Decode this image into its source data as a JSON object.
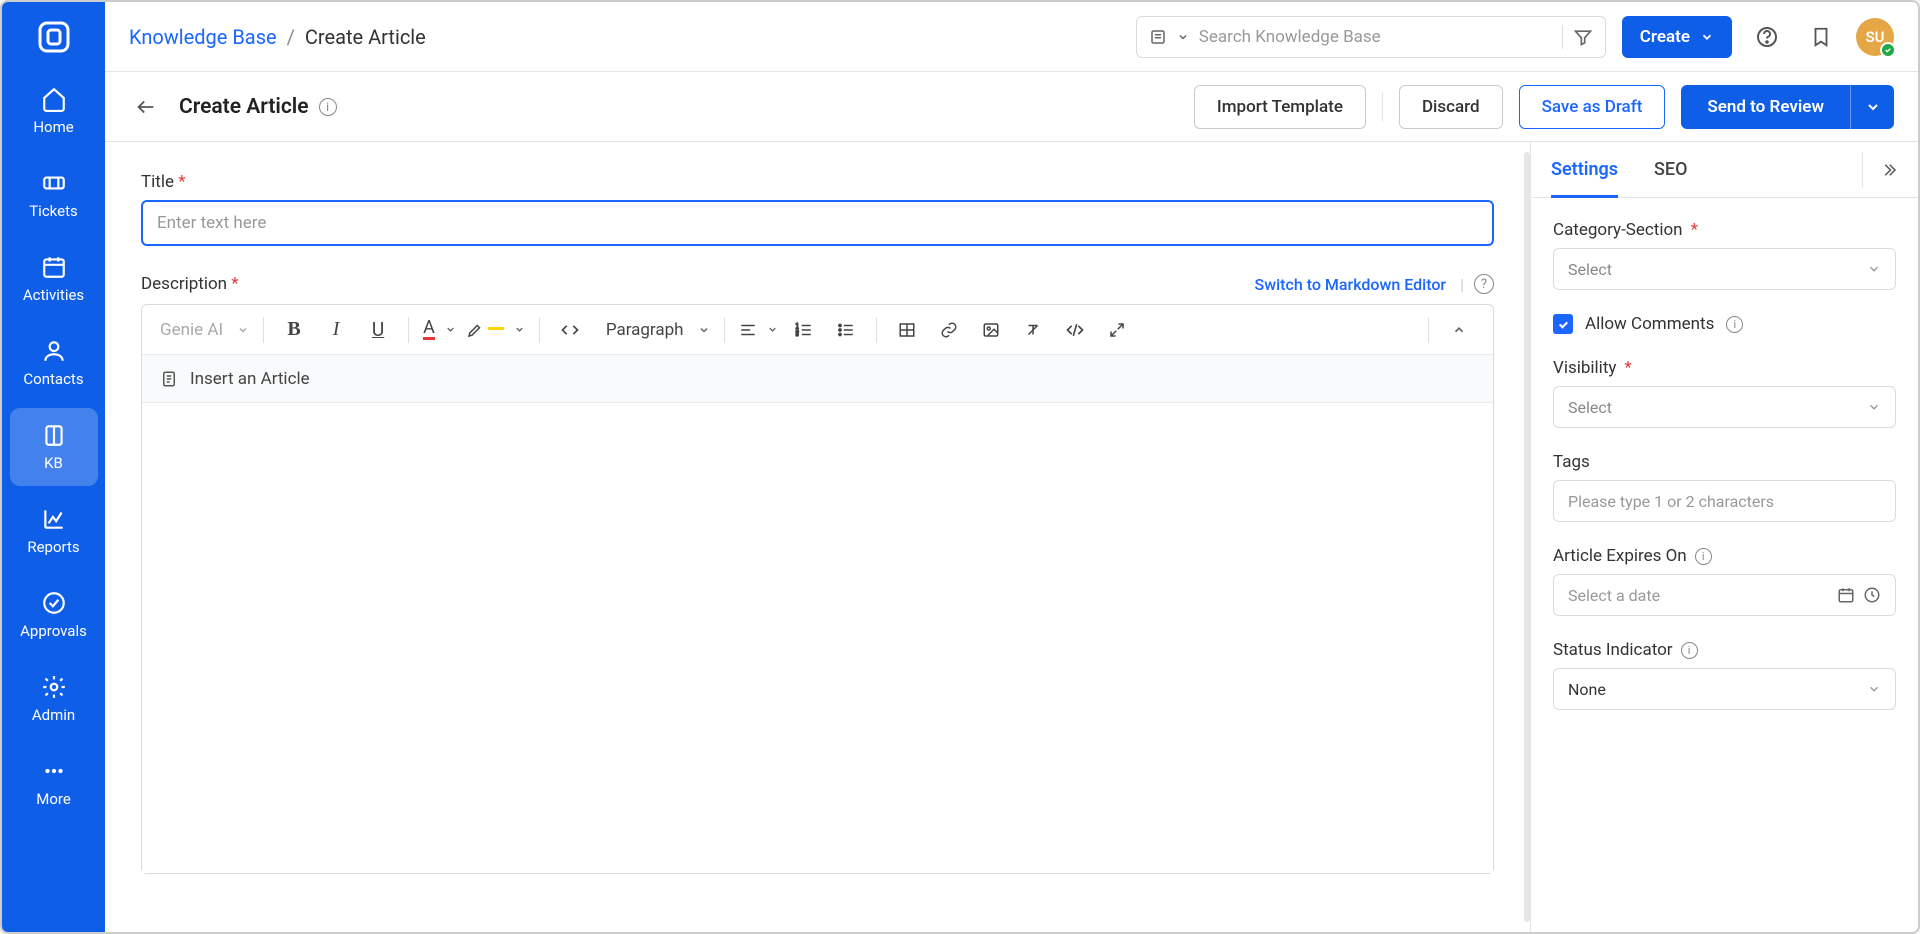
{
  "nav": {
    "items": [
      {
        "label": "Home"
      },
      {
        "label": "Tickets"
      },
      {
        "label": "Activities"
      },
      {
        "label": "Contacts"
      },
      {
        "label": "KB"
      },
      {
        "label": "Reports"
      },
      {
        "label": "Approvals"
      },
      {
        "label": "Admin"
      },
      {
        "label": "More"
      }
    ]
  },
  "header": {
    "breadcrumb_link": "Knowledge Base",
    "breadcrumb_sep": "/",
    "breadcrumb_current": "Create Article",
    "search_placeholder": "Search Knowledge Base",
    "create_label": "Create",
    "avatar_initials": "SU"
  },
  "actions": {
    "page_title": "Create Article",
    "import": "Import Template",
    "discard": "Discard",
    "save_draft": "Save as Draft",
    "send_review": "Send to Review"
  },
  "form": {
    "title_label": "Title",
    "title_placeholder": "Enter text here",
    "desc_label": "Description",
    "switch_link": "Switch to Markdown Editor",
    "genie": "Genie AI",
    "paragraph": "Paragraph",
    "insert_article": "Insert an Article"
  },
  "sidebar": {
    "tab_settings": "Settings",
    "tab_seo": "SEO",
    "category_label": "Category-Section",
    "select_placeholder": "Select",
    "allow_comments": "Allow Comments",
    "visibility_label": "Visibility",
    "tags_label": "Tags",
    "tags_placeholder": "Please type 1 or 2 characters",
    "expires_label": "Article Expires On",
    "expires_placeholder": "Select a date",
    "status_label": "Status Indicator",
    "status_value": "None"
  }
}
